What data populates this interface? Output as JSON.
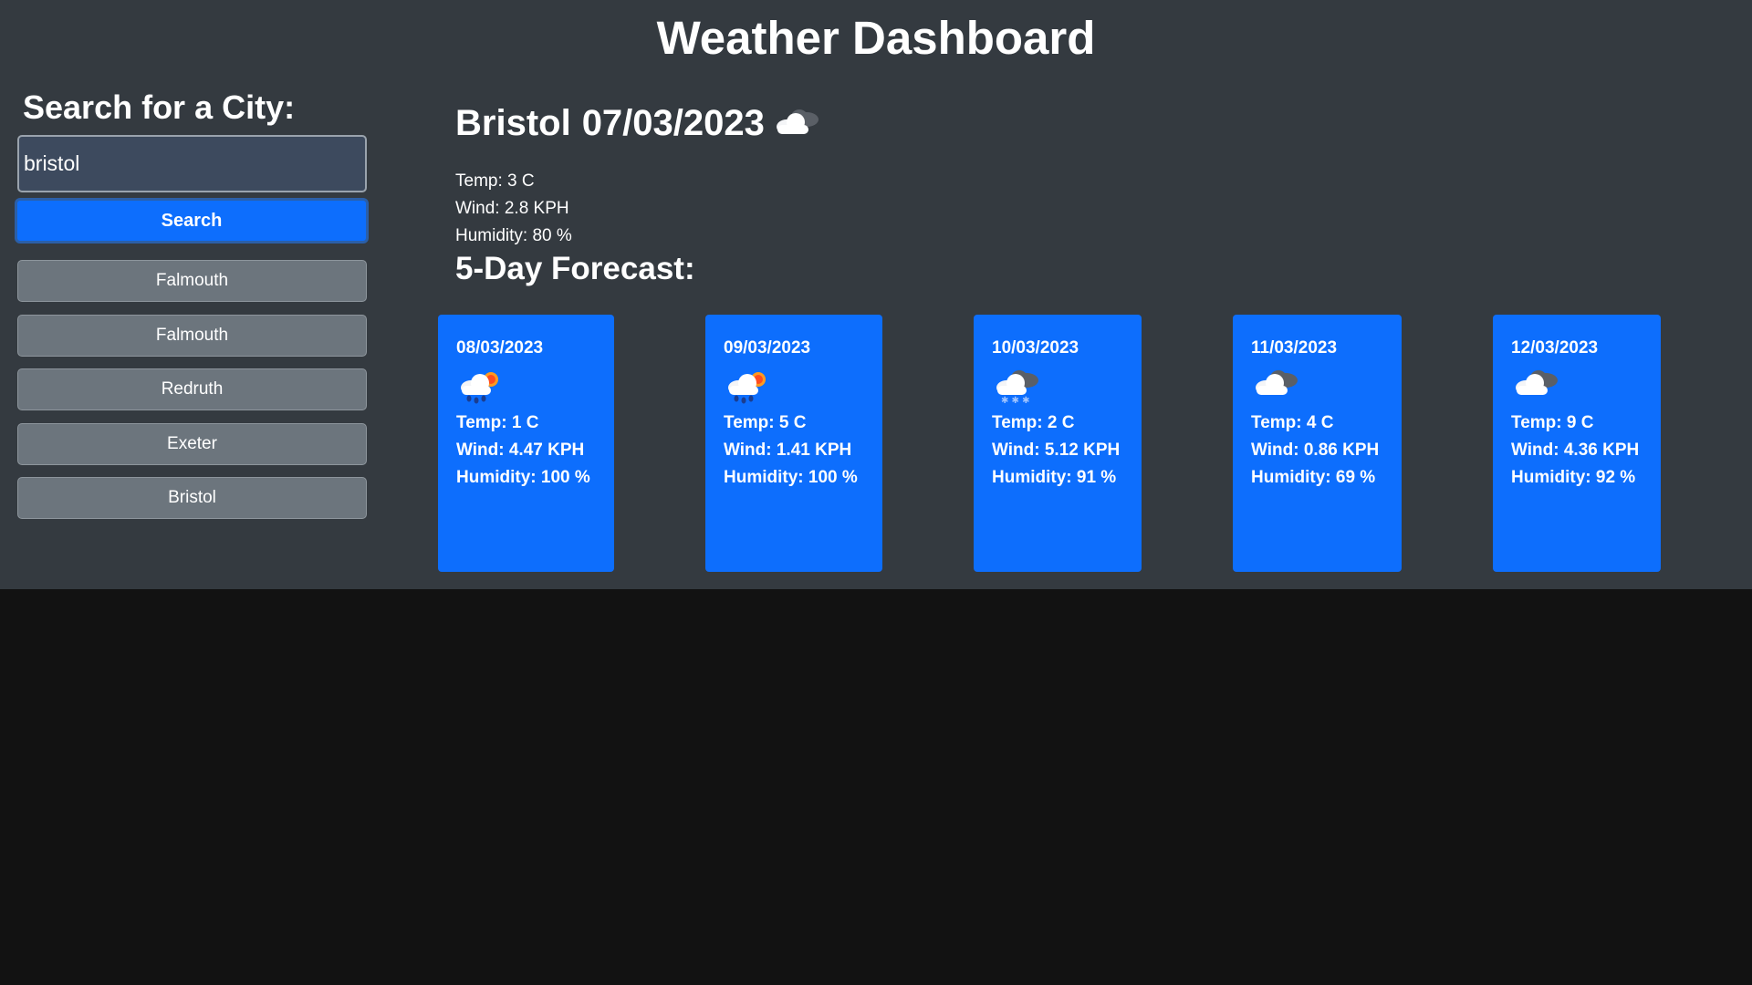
{
  "app": {
    "title": "Weather Dashboard"
  },
  "search": {
    "heading": "Search for a City:",
    "value": "bristol",
    "button_label": "Search"
  },
  "history": [
    "Falmouth",
    "Falmouth",
    "Redruth",
    "Exeter",
    "Bristol"
  ],
  "current": {
    "city": "Bristol",
    "date": "07/03/2023",
    "icon": "cloud-icon",
    "temp": "Temp: 3 C",
    "wind": "Wind: 2.8 KPH",
    "humidity": "Humidity: 80 %"
  },
  "forecast": {
    "heading": "5-Day Forecast:",
    "days": [
      {
        "date": "08/03/2023",
        "icon": "rain-sun-icon",
        "temp": "Temp: 1 C",
        "wind": "Wind: 4.47 KPH",
        "humidity": "Humidity: 100 %"
      },
      {
        "date": "09/03/2023",
        "icon": "rain-sun-icon",
        "temp": "Temp: 5 C",
        "wind": "Wind: 1.41 KPH",
        "humidity": "Humidity: 100 %"
      },
      {
        "date": "10/03/2023",
        "icon": "snow-cloud-icon",
        "temp": "Temp: 2 C",
        "wind": "Wind: 5.12 KPH",
        "humidity": "Humidity: 91 %"
      },
      {
        "date": "11/03/2023",
        "icon": "cloud-icon",
        "temp": "Temp: 4 C",
        "wind": "Wind: 0.86 KPH",
        "humidity": "Humidity: 69 %"
      },
      {
        "date": "12/03/2023",
        "icon": "cloud-icon",
        "temp": "Temp: 9 C",
        "wind": "Wind: 4.36 KPH",
        "humidity": "Humidity: 92 %"
      }
    ]
  },
  "colors": {
    "header_bg": "#343a40",
    "page_bg": "#121212",
    "primary": "#0d6efd",
    "secondary": "#6c757d"
  }
}
